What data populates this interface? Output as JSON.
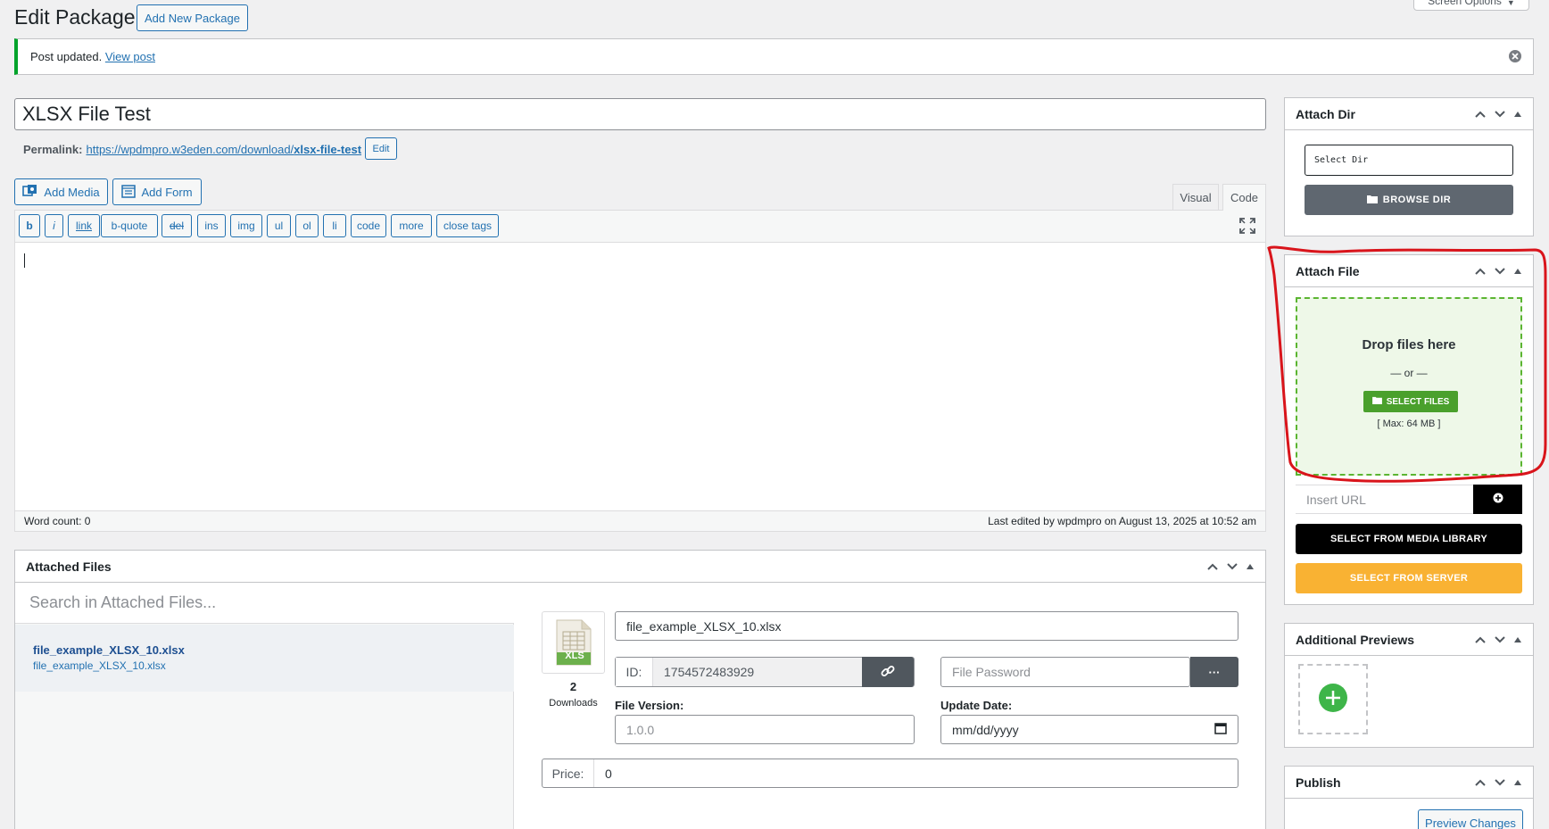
{
  "header": {
    "title": "Edit Package",
    "add_new_label": "Add New Package",
    "screen_options_label": "Screen Options"
  },
  "notice": {
    "text": "Post updated.",
    "link_label": "View post"
  },
  "post": {
    "title_value": "XLSX File Test",
    "permalink_label": "Permalink:",
    "permalink_base": "https://wpdmpro.w3eden.com/download/",
    "permalink_slug": "xlsx-file-test",
    "permalink_edit_label": "Edit"
  },
  "editor": {
    "add_media_label": "Add Media",
    "add_form_label": "Add Form",
    "tab_visual": "Visual",
    "tab_code": "Code",
    "quicktags": [
      "b",
      "i",
      "link",
      "b-quote",
      "del",
      "ins",
      "img",
      "ul",
      "ol",
      "li",
      "code",
      "more",
      "close tags"
    ],
    "word_count": "Word count: 0",
    "last_edited": "Last edited by wpdmpro on August 13, 2025 at 10:52 am"
  },
  "attached_files": {
    "title": "Attached Files",
    "search_placeholder": "Search in Attached Files...",
    "file_name": "file_example_XLSX_10.xlsx",
    "file_sub": "file_example_XLSX_10.xlsx",
    "file_icon_label": "XLS",
    "downloads_count": "2",
    "downloads_label": "Downloads",
    "file_title_value": "file_example_XLSX_10.xlsx",
    "id_label": "ID:",
    "id_value": "1754572483929",
    "password_placeholder": "File Password",
    "password_btn": "···",
    "version_label": "File Version:",
    "version_placeholder": "1.0.0",
    "update_label": "Update Date:",
    "update_placeholder": "mm/dd/yyyy",
    "price_label": "Price:",
    "price_value": "0"
  },
  "attach_dir": {
    "title": "Attach Dir",
    "select_placeholder": "Select Dir",
    "browse_label": "BROWSE DIR"
  },
  "attach_file": {
    "title": "Attach File",
    "drop_text": "Drop files here",
    "or_text": "— or —",
    "select_files_label": "SELECT FILES",
    "max_text": "[ Max: 64 MB ]",
    "url_placeholder": "Insert URL",
    "media_library_label": "SELECT FROM MEDIA LIBRARY",
    "server_label": "SELECT FROM SERVER"
  },
  "additional_previews": {
    "title": "Additional Previews"
  },
  "publish": {
    "title": "Publish",
    "preview_label": "Preview Changes"
  },
  "colors": {
    "accent": "#2271b1",
    "success": "#00a32a",
    "dropzone_bg": "#eef8e8",
    "dropzone_border": "#5bb531",
    "server_btn": "#f9b233",
    "annotation": "#d9141b"
  }
}
